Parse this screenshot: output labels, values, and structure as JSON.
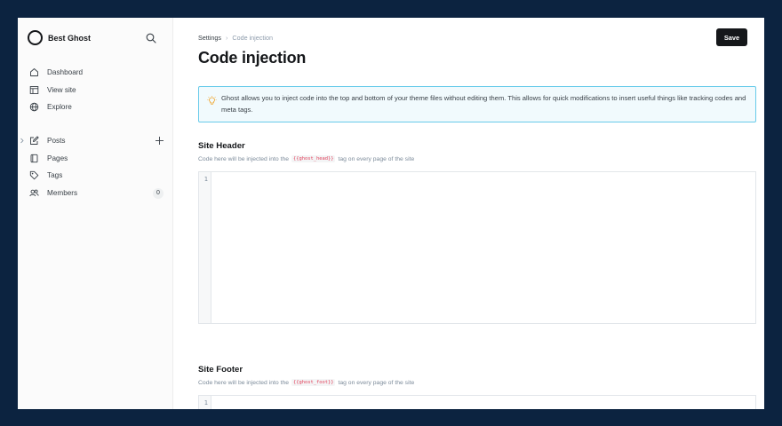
{
  "sidebar": {
    "brand_name": "Best Ghost",
    "primary_items": [
      {
        "label": "Dashboard",
        "icon": "home-icon"
      },
      {
        "label": "View site",
        "icon": "window-icon"
      },
      {
        "label": "Explore",
        "icon": "globe-icon"
      }
    ],
    "secondary_items": [
      {
        "label": "Posts",
        "icon": "edit-icon"
      },
      {
        "label": "Pages",
        "icon": "page-icon"
      },
      {
        "label": "Tags",
        "icon": "tag-icon"
      },
      {
        "label": "Members",
        "icon": "members-icon",
        "count": "0"
      }
    ]
  },
  "header": {
    "breadcrumb_parent": "Settings",
    "breadcrumb_separator": "›",
    "breadcrumb_current": "Code injection",
    "title": "Code injection",
    "save_label": "Save"
  },
  "notice": {
    "icon": "lightbulb-icon",
    "text": "Ghost allows you to inject code into the top and bottom of your theme files without editing them. This allows for quick modifications to insert useful things like tracking codes and meta tags."
  },
  "site_header": {
    "title": "Site Header",
    "hint_before": "Code here will be injected into the",
    "hint_tag": "{{ghost_head}}",
    "hint_after": "tag on every page of the site",
    "line_number": "1"
  },
  "site_footer": {
    "title": "Site Footer",
    "hint_before": "Code here will be injected into the",
    "hint_tag": "{{ghost_foot}}",
    "hint_after": "tag on every page of the site",
    "line_number": "1"
  },
  "colors": {
    "background": "#0c2340",
    "accent_notice_border": "#68cbea",
    "code_tag": "#e2425c",
    "button": "#15171a"
  }
}
